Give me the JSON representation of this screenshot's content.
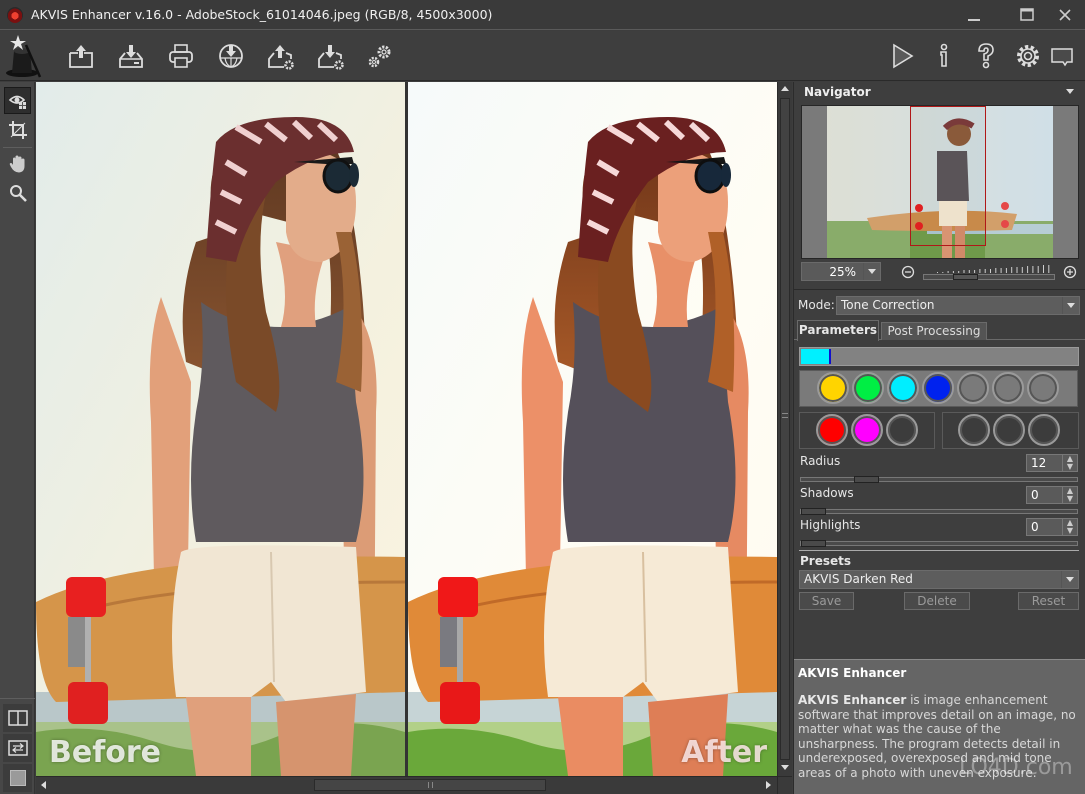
{
  "window": {
    "title": "AKVIS Enhancer v.16.0 - AdobeStock_61014046.jpeg (RGB/8, 4500x3000)",
    "controls": [
      "minimize",
      "maximize",
      "close"
    ]
  },
  "toolbar": {
    "left": [
      {
        "name": "open-image",
        "icon": "tray-upload-icon"
      },
      {
        "name": "save-image",
        "icon": "tray-download-icon"
      },
      {
        "name": "print-image",
        "icon": "printer-icon"
      },
      {
        "name": "share-image",
        "icon": "globe-download-icon"
      },
      {
        "name": "load-settings",
        "icon": "tray-upload-gear-icon"
      },
      {
        "name": "save-settings",
        "icon": "tray-download-gear-icon"
      },
      {
        "name": "batch-processing",
        "icon": "gears-icon"
      }
    ],
    "right": [
      {
        "name": "run-processing",
        "icon": "play-icon"
      },
      {
        "name": "about",
        "icon": "info-icon"
      },
      {
        "name": "help",
        "icon": "help-icon"
      },
      {
        "name": "preferences",
        "icon": "gear-icon"
      },
      {
        "name": "hints",
        "icon": "speech-bubble-icon"
      }
    ]
  },
  "left_tools": [
    {
      "name": "preview-window",
      "icon": "eye-preview-icon",
      "active": true
    },
    {
      "name": "crop",
      "icon": "crop-icon",
      "active": false
    },
    {
      "name": "hand",
      "icon": "hand-icon",
      "active": false
    },
    {
      "name": "zoom",
      "icon": "magnifier-icon",
      "active": false
    }
  ],
  "view_modes": [
    {
      "name": "two-panels",
      "icon": "split-view-icon"
    },
    {
      "name": "switch-before-after",
      "icon": "swap-icon"
    },
    {
      "name": "background-color",
      "icon": "color-square-icon"
    }
  ],
  "canvas": {
    "before_label": "Before",
    "after_label": "After"
  },
  "navigator": {
    "title": "Navigator",
    "zoom_value": "25%"
  },
  "settings": {
    "mode_label": "Mode:",
    "mode_value": "Tone Correction",
    "tabs": [
      {
        "label": "Parameters",
        "active": true
      },
      {
        "label": "Post Processing",
        "active": false
      }
    ],
    "color_bar": {
      "color": "#00f0ff",
      "fill": 0.11
    },
    "colors_row1": [
      "#ffd400",
      "#00ee44",
      "#00eeff",
      "#0022ee",
      "",
      "",
      ""
    ],
    "colors_row2a": [
      "#ff0000",
      "#ff00ff",
      ""
    ],
    "colors_row2b": [
      "",
      "",
      ""
    ],
    "params": [
      {
        "label": "Radius",
        "value": "12",
        "level": 0.21
      },
      {
        "label": "Shadows",
        "value": "0",
        "level": 0.0
      },
      {
        "label": "Highlights",
        "value": "0",
        "level": 0.0
      }
    ]
  },
  "presets": {
    "title": "Presets",
    "selected": "AKVIS Darken Red",
    "buttons": {
      "save": "Save",
      "delete": "Delete",
      "reset": "Reset"
    }
  },
  "hints": {
    "title": "AKVIS Enhancer",
    "body_bold": "AKVIS Enhancer",
    "body": " is image enhancement software that improves detail on an image, no matter what was the cause of the unsharpness. The program detects detail in underexposed, overexposed and mid tone areas of a photo with uneven exposure."
  },
  "watermark": "LO4D.com"
}
